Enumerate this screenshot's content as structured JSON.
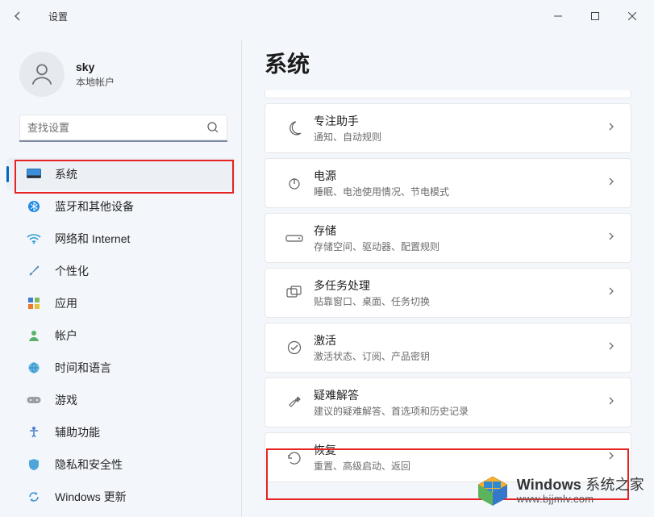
{
  "window": {
    "app": "设置"
  },
  "user": {
    "name": "sky",
    "account_type": "本地帐户"
  },
  "search": {
    "placeholder": "查找设置"
  },
  "sidebar": {
    "items": [
      {
        "label": "系统",
        "icon": "monitor-icon",
        "selected": true
      },
      {
        "label": "蓝牙和其他设备",
        "icon": "bluetooth-icon"
      },
      {
        "label": "网络和 Internet",
        "icon": "wifi-icon"
      },
      {
        "label": "个性化",
        "icon": "brush-icon"
      },
      {
        "label": "应用",
        "icon": "apps-icon"
      },
      {
        "label": "帐户",
        "icon": "person-icon"
      },
      {
        "label": "时间和语言",
        "icon": "globe-icon"
      },
      {
        "label": "游戏",
        "icon": "gamepad-icon"
      },
      {
        "label": "辅助功能",
        "icon": "accessibility-icon"
      },
      {
        "label": "隐私和安全性",
        "icon": "shield-icon"
      },
      {
        "label": "Windows 更新",
        "icon": "update-icon"
      }
    ]
  },
  "page": {
    "title": "系统"
  },
  "rows": [
    {
      "key": "focus",
      "title": "专注助手",
      "sub": "通知、自动规则",
      "icon": "moon-icon"
    },
    {
      "key": "power",
      "title": "电源",
      "sub": "睡眠、电池使用情况、节电模式",
      "icon": "power-icon"
    },
    {
      "key": "storage",
      "title": "存储",
      "sub": "存储空间、驱动器、配置规则",
      "icon": "drive-icon"
    },
    {
      "key": "multitask",
      "title": "多任务处理",
      "sub": "贴靠窗口、桌面、任务切换",
      "icon": "multitask-icon"
    },
    {
      "key": "activate",
      "title": "激活",
      "sub": "激活状态、订阅、产品密钥",
      "icon": "check-icon"
    },
    {
      "key": "trouble",
      "title": "疑难解答",
      "sub": "建议的疑难解答、首选项和历史记录",
      "icon": "wrench-icon"
    },
    {
      "key": "recovery",
      "title": "恢复",
      "sub": "重置、高级启动、返回",
      "icon": "recovery-icon"
    }
  ],
  "watermark": {
    "brand_bold": "Windows",
    "brand_rest": "系统之家",
    "url": "www.bjjmlv.com"
  }
}
